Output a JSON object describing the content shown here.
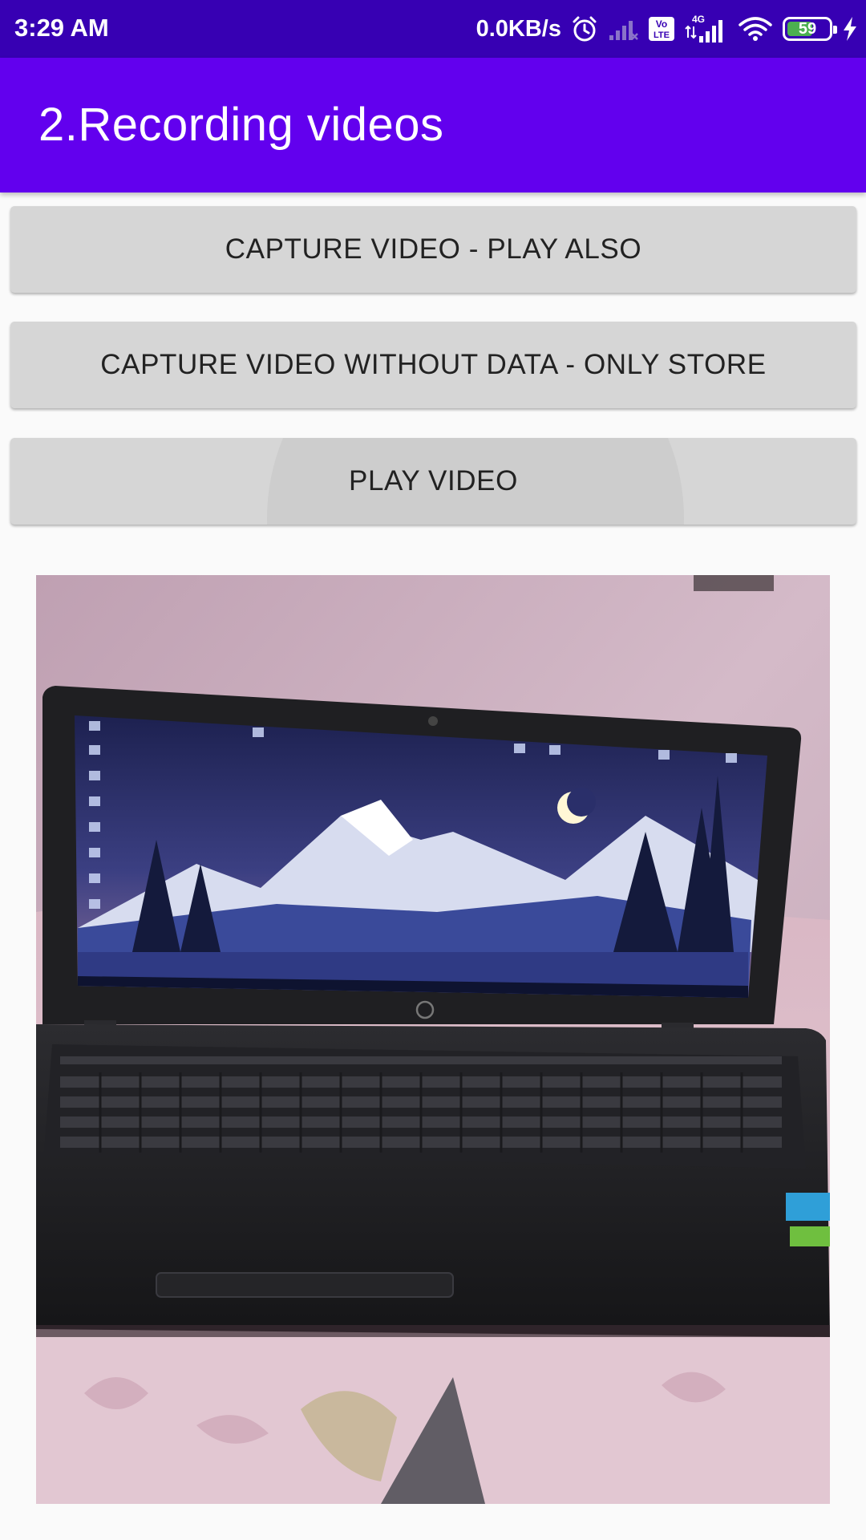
{
  "status_bar": {
    "time": "3:29 AM",
    "net_speed": "0.0KB/s",
    "network_type": "4G",
    "volte_top": "Vo",
    "volte_bottom": "LTE",
    "battery_level": "59",
    "icons": [
      "alarm-icon",
      "signal-weak-icon",
      "volte-icon",
      "signal-4g-icon",
      "wifi-icon",
      "battery-icon",
      "charging-icon"
    ]
  },
  "app_bar": {
    "title": "2.Recording videos",
    "color": "#6200ee",
    "status_color": "#3700b3"
  },
  "buttons": {
    "capture_play": "CAPTURE VIDEO - PLAY ALSO",
    "capture_store": "CAPTURE VIDEO WITHOUT DATA - ONLY STORE",
    "play_video": "PLAY VIDEO"
  }
}
